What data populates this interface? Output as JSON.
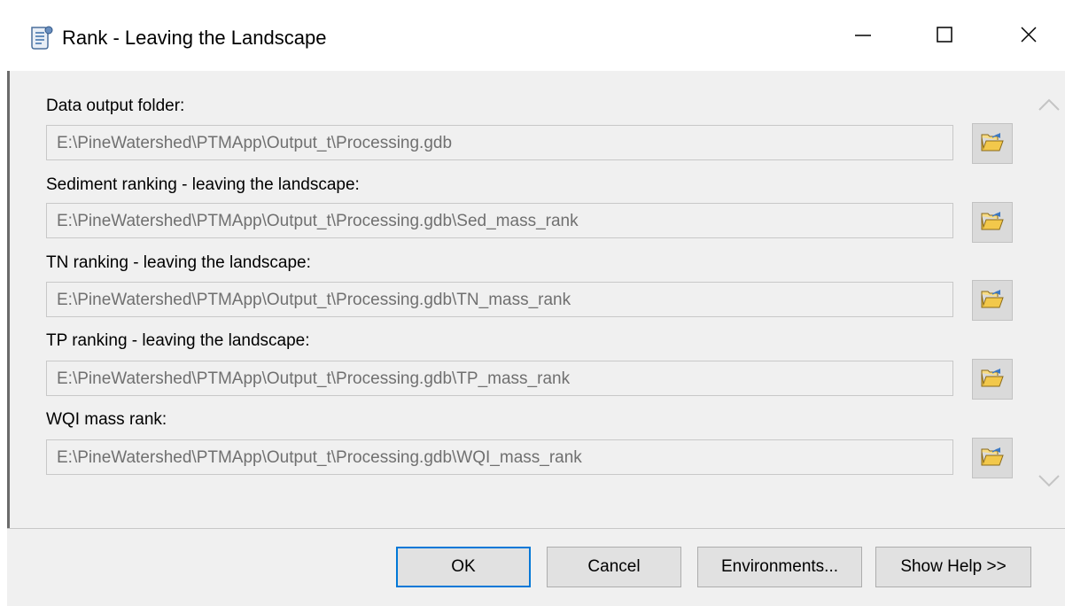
{
  "window": {
    "title": "Rank - Leaving the Landscape",
    "icons": {
      "app": "script-tool-icon",
      "minimize": "minimize-icon",
      "maximize": "maximize-icon",
      "close": "close-icon"
    }
  },
  "parameters": [
    {
      "label": "Data output folder:",
      "value": "E:\\PineWatershed\\PTMApp\\Output_t\\Processing.gdb"
    },
    {
      "label": "Sediment ranking - leaving the landscape:",
      "value": "E:\\PineWatershed\\PTMApp\\Output_t\\Processing.gdb\\Sed_mass_rank"
    },
    {
      "label": "TN ranking - leaving the landscape:",
      "value": "E:\\PineWatershed\\PTMApp\\Output_t\\Processing.gdb\\TN_mass_rank"
    },
    {
      "label": "TP ranking - leaving the landscape:",
      "value": "E:\\PineWatershed\\PTMApp\\Output_t\\Processing.gdb\\TP_mass_rank"
    },
    {
      "label": "WQI mass rank:",
      "value": "E:\\PineWatershed\\PTMApp\\Output_t\\Processing.gdb\\WQI_mass_rank"
    }
  ],
  "browse_icon": "open-folder-icon",
  "buttons": {
    "ok": "OK",
    "cancel": "Cancel",
    "environments": "Environments...",
    "show_help": "Show Help >>"
  },
  "colors": {
    "focus_border": "#0078d7",
    "panel_background": "#f0f0f0",
    "disabled_text": "#707070",
    "folder_icon": "#f2c84b"
  }
}
